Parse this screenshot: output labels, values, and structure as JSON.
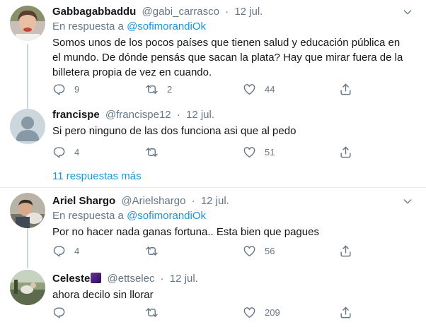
{
  "tweets": [
    {
      "name": "Gabbagabbaddu",
      "handle": "@gabi_carrasco",
      "time": "12 jul.",
      "replying_prefix": "En respuesta a",
      "replying_to": "@sofimorandiOk",
      "text": "Somos unos de los pocos países que tienen salud y educación pública en el mundo. De dónde pensás que sacan la plata? Hay que mirar fuera de la billetera propia de vez en cuando.",
      "replies": "9",
      "retweets": "2",
      "likes": "44"
    },
    {
      "name": "francispe",
      "handle": "@francispe12",
      "time": "12 jul.",
      "text": "Si pero ninguno de las dos funciona asi que al pedo",
      "replies": "4",
      "retweets": "",
      "likes": "51"
    },
    {
      "name": "Ariel Shargo",
      "handle": "@Arielshargo",
      "time": "12 jul.",
      "replying_prefix": "En respuesta a",
      "replying_to": "@sofimorandiOk",
      "text": "Por no hacer nada ganas fortuna.. Esta bien que pagues",
      "replies": "4",
      "retweets": "",
      "likes": "56"
    },
    {
      "name": "Celeste",
      "handle": "@ettselec",
      "time": "12 jul.",
      "text": "ahora decilo sin llorar",
      "replies": "",
      "retweets": "",
      "likes": "209"
    }
  ],
  "more_replies": "11 respuestas más",
  "icons": {
    "reply": "reply-icon",
    "retweet": "retweet-icon",
    "like": "heart-icon",
    "share": "share-icon",
    "caret": "chevron-down-icon"
  },
  "colors": {
    "link": "#1b95e0",
    "muted": "#657786",
    "text": "#14171a"
  }
}
